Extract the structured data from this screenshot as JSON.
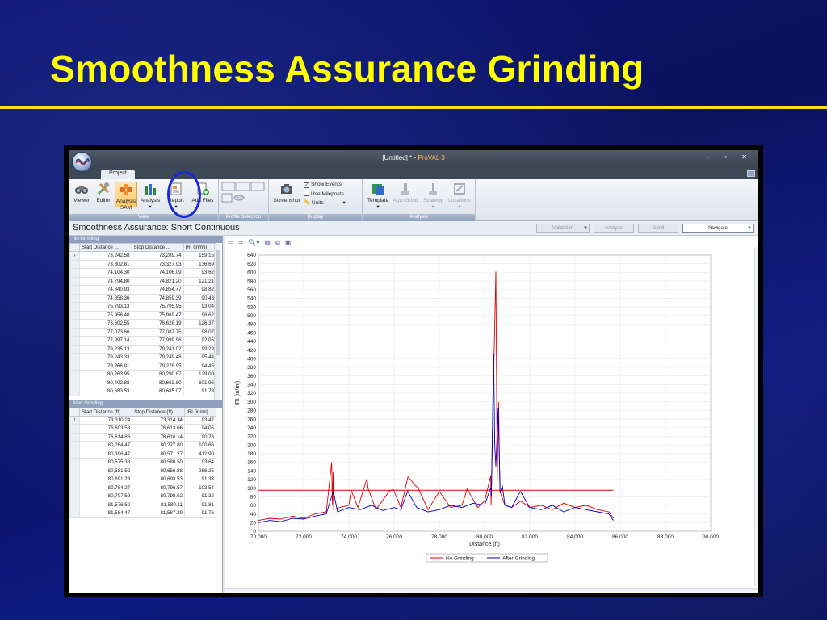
{
  "slide": {
    "title": "Smoothness Assurance Grinding"
  },
  "window": {
    "title_doc": "[Untitled] * - ",
    "title_app": "ProVAL 3",
    "controls": "– ▫ ✕"
  },
  "tabs": {
    "project": "Project"
  },
  "ribbon": {
    "view_group": "View",
    "profile_group": "Profile Selection",
    "display_group": "Display",
    "analysis_group": "Analysis",
    "viewer": "Viewer",
    "editor": "Editor",
    "analysis_sam_1": "Analysis",
    "analysis_sam_2": "SAM",
    "analysis": "Analysis",
    "report": "Report",
    "add_files": "Add Files",
    "screenshot": "Screenshot",
    "show_events": "Show Events",
    "use_mileposts": "Use Mileposts",
    "units": "Units",
    "template": "Template",
    "auto_grind": "Auto Grind",
    "strategy": "Strategy",
    "locations": "Locations"
  },
  "content": {
    "title": "Smoothness Assurance: Short Continuous",
    "validation": "Validation",
    "analyze": "Analyze",
    "grind": "Grind",
    "navigate": "Navigate"
  },
  "no_grinding": {
    "caption": "No Grinding",
    "headers": [
      "Start Distance ...",
      "Stop Distance ...",
      "IRI (in/mi)"
    ],
    "rows": [
      [
        "73,242.58",
        "73,289.74",
        "159.15"
      ],
      [
        "73,302.81",
        "73,327.93",
        "136.69"
      ],
      [
        "74,104.30",
        "74,106.09",
        "93.62"
      ],
      [
        "74,794.80",
        "74,821.20",
        "121.21"
      ],
      [
        "74,840.93",
        "74,854.77",
        "98.82"
      ],
      [
        "74,858.36",
        "74,859.39",
        "90.43"
      ],
      [
        "75,793.13",
        "75,795.95",
        "93.04"
      ],
      [
        "75,956.40",
        "75,969.47",
        "96.62"
      ],
      [
        "76,602.55",
        "76,628.19",
        "126.37"
      ],
      [
        "77,073.66",
        "77,087.75",
        "98.07"
      ],
      [
        "77,997.14",
        "77,999.96",
        "92.05"
      ],
      [
        "79,235.13",
        "79,241.02",
        "99.29"
      ],
      [
        "79,243.33",
        "79,249.48",
        "95.44"
      ],
      [
        "79,266.91",
        "79,278.95",
        "94.45"
      ],
      [
        "80,263.95",
        "80,290.87",
        "129.00"
      ],
      [
        "80,402.88",
        "80,663.80",
        "601.96"
      ],
      [
        "80,683.53",
        "80,685.07",
        "91.73"
      ]
    ]
  },
  "after_grinding": {
    "caption": "After Grinding",
    "headers": [
      "Start Distance (ft)",
      "Stop Distance (ft)",
      "IRI (in/mi)"
    ],
    "rows": [
      [
        "73,310.24",
        "73,314.34",
        "93.47"
      ],
      [
        "76,603.58",
        "76,613.06",
        "94.05"
      ],
      [
        "76,614.86",
        "76,616.14",
        "90.76"
      ],
      [
        "80,264.47",
        "80,277.80",
        "100.66"
      ],
      [
        "80,396.47",
        "80,571.27",
        "412.90"
      ],
      [
        "80,575.38",
        "80,580.50",
        "93.64"
      ],
      [
        "80,581.52",
        "80,656.88",
        "286.25"
      ],
      [
        "80,691.23",
        "80,693.53",
        "91.33"
      ],
      [
        "80,784.27",
        "80,796.57",
        "103.54"
      ],
      [
        "80,797.59",
        "80,798.62",
        "91.32"
      ],
      [
        "81,576.52",
        "81,580.11",
        "91.81"
      ],
      [
        "81,584.47",
        "81,587.29",
        "91.76"
      ]
    ]
  },
  "chart_data": {
    "type": "line",
    "xlabel": "Distance (ft)",
    "ylabel": "IRI (in/mi)",
    "xlim": [
      70000,
      90000
    ],
    "ylim": [
      0,
      640
    ],
    "xticks": [
      70000,
      72000,
      74000,
      76000,
      78000,
      80000,
      82000,
      84000,
      86000,
      88000,
      90000
    ],
    "xtick_labels": [
      "70,000",
      "72,000",
      "74,000",
      "76,000",
      "78,000",
      "80,000",
      "82,000",
      "84,000",
      "86,000",
      "88,000",
      "90,000"
    ],
    "yticks": [
      0,
      20,
      40,
      60,
      80,
      100,
      120,
      140,
      160,
      180,
      200,
      220,
      240,
      260,
      280,
      300,
      320,
      340,
      360,
      380,
      400,
      420,
      440,
      460,
      480,
      500,
      520,
      540,
      560,
      580,
      600,
      620,
      640
    ],
    "grid": true,
    "legend": "bottom-center",
    "threshold": {
      "x": [
        70000,
        85700
      ],
      "y": 95,
      "color": "#e00000"
    },
    "series": [
      {
        "name": "No Grinding",
        "color": "#e00000",
        "x": [
          70000,
          70500,
          71000,
          71500,
          72000,
          72500,
          73000,
          73240,
          73270,
          73300,
          73330,
          73600,
          74000,
          74100,
          74400,
          74800,
          74850,
          75200,
          75790,
          75960,
          76300,
          76610,
          77080,
          77500,
          78000,
          78500,
          79000,
          79240,
          79270,
          79700,
          80000,
          80270,
          80290,
          80410,
          80500,
          80560,
          80620,
          80680,
          80900,
          81200,
          81600,
          82000,
          82500,
          83000,
          83500,
          84000,
          84500,
          85000,
          85500,
          85700
        ],
        "y": [
          25,
          30,
          28,
          35,
          30,
          40,
          45,
          160,
          60,
          137,
          50,
          55,
          60,
          95,
          55,
          122,
          99,
          50,
          93,
          97,
          55,
          126,
          98,
          50,
          92,
          55,
          60,
          99,
          94,
          55,
          70,
          128,
          60,
          380,
          602,
          120,
          300,
          92,
          60,
          55,
          70,
          55,
          60,
          50,
          65,
          55,
          60,
          50,
          45,
          30
        ]
      },
      {
        "name": "After Grinding",
        "color": "#0000d0",
        "x": [
          70000,
          70500,
          71000,
          71500,
          72000,
          72500,
          73000,
          73310,
          73500,
          74000,
          74500,
          75000,
          75500,
          76000,
          76300,
          76605,
          76615,
          77000,
          77500,
          78000,
          78500,
          79000,
          79500,
          80000,
          80270,
          80300,
          80400,
          80450,
          80500,
          80600,
          80690,
          80790,
          80900,
          81200,
          81580,
          81590,
          82000,
          82500,
          83000,
          83500,
          84000,
          84500,
          85000,
          85500,
          85700
        ],
        "y": [
          20,
          25,
          22,
          30,
          28,
          35,
          40,
          93,
          45,
          55,
          50,
          60,
          48,
          55,
          50,
          94,
          91,
          55,
          45,
          50,
          60,
          55,
          65,
          60,
          101,
          80,
          413,
          200,
          150,
          286,
          91,
          104,
          60,
          55,
          92,
          92,
          55,
          50,
          60,
          45,
          55,
          50,
          45,
          40,
          25
        ]
      }
    ]
  }
}
